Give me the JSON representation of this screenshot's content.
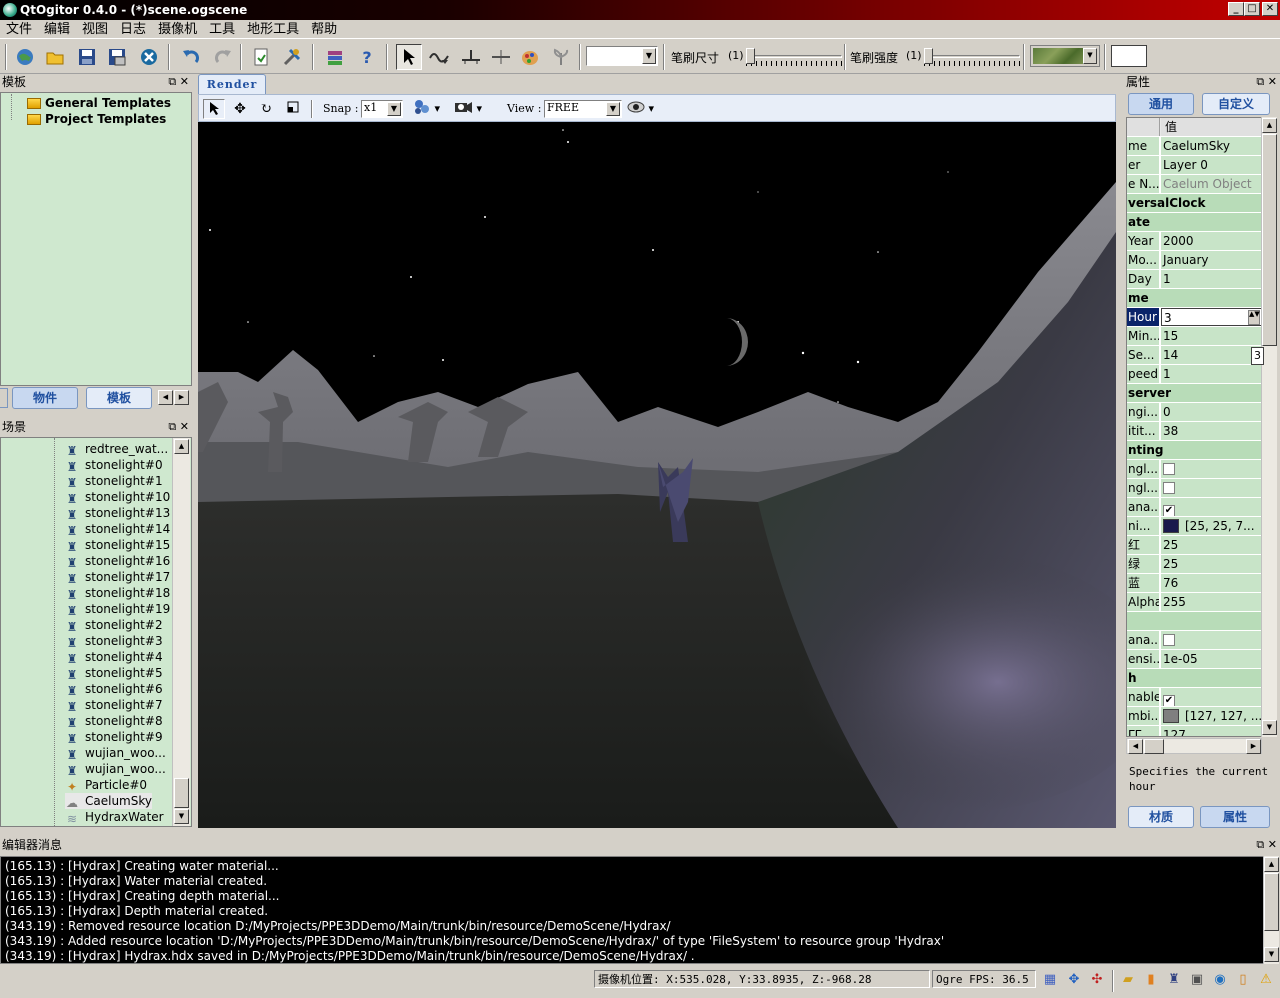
{
  "window": {
    "title": "QtOgitor 0.4.0 - (*)scene.ogscene",
    "minimize": "_",
    "maximize": "□",
    "close": "✕"
  },
  "menu": [
    "文件",
    "编辑",
    "视图",
    "日志",
    "摄像机",
    "工具",
    "地形工具",
    "帮助"
  ],
  "toolbar": {
    "brush_size_label": "笔刷尺寸",
    "brush_size_value": "(1)",
    "brush_strength_label": "笔刷强度",
    "brush_strength_value": "(1)",
    "mode_combo_value": ""
  },
  "templates_panel": {
    "title": "模板",
    "items": [
      "General Templates",
      "Project Templates"
    ],
    "tabs": [
      "物件",
      "模板"
    ]
  },
  "scene_panel": {
    "title": "场景",
    "items": [
      {
        "label": "redtree_wat...",
        "icon": "entity-icon"
      },
      {
        "label": "stonelight#0",
        "icon": "entity-icon"
      },
      {
        "label": "stonelight#1",
        "icon": "entity-icon"
      },
      {
        "label": "stonelight#10",
        "icon": "entity-icon"
      },
      {
        "label": "stonelight#13",
        "icon": "entity-icon"
      },
      {
        "label": "stonelight#14",
        "icon": "entity-icon"
      },
      {
        "label": "stonelight#15",
        "icon": "entity-icon"
      },
      {
        "label": "stonelight#16",
        "icon": "entity-icon"
      },
      {
        "label": "stonelight#17",
        "icon": "entity-icon"
      },
      {
        "label": "stonelight#18",
        "icon": "entity-icon"
      },
      {
        "label": "stonelight#19",
        "icon": "entity-icon"
      },
      {
        "label": "stonelight#2",
        "icon": "entity-icon"
      },
      {
        "label": "stonelight#3",
        "icon": "entity-icon"
      },
      {
        "label": "stonelight#4",
        "icon": "entity-icon"
      },
      {
        "label": "stonelight#5",
        "icon": "entity-icon"
      },
      {
        "label": "stonelight#6",
        "icon": "entity-icon"
      },
      {
        "label": "stonelight#7",
        "icon": "entity-icon"
      },
      {
        "label": "stonelight#8",
        "icon": "entity-icon"
      },
      {
        "label": "stonelight#9",
        "icon": "entity-icon"
      },
      {
        "label": "wujian_woo...",
        "icon": "entity-icon"
      },
      {
        "label": "wujian_woo...",
        "icon": "entity-icon"
      },
      {
        "label": "Particle#0",
        "icon": "particle-icon"
      },
      {
        "label": "CaelumSky",
        "icon": "sky-icon"
      },
      {
        "label": "HydraxWater",
        "icon": "water-icon"
      }
    ],
    "selected": "CaelumSky"
  },
  "render": {
    "tab": "Render",
    "snap_label": "Snap :",
    "snap_value": "x1",
    "view_label": "View :",
    "view_value": "FREE"
  },
  "properties_panel": {
    "title": "属性",
    "tabs": [
      "通用",
      "自定义"
    ],
    "header_value": "值",
    "rows": [
      {
        "k": "me",
        "v": "CaelumSky",
        "type": "text"
      },
      {
        "k": "er",
        "v": "Layer 0",
        "type": "text"
      },
      {
        "k": "e N...",
        "v": "Caelum Object",
        "type": "disabled"
      },
      {
        "k": "versalClock",
        "v": "",
        "type": "group"
      },
      {
        "k": "ate",
        "v": "",
        "type": "group"
      },
      {
        "k": "Year",
        "v": "2000",
        "type": "text"
      },
      {
        "k": "Mo...",
        "v": "January",
        "type": "text"
      },
      {
        "k": "Day",
        "v": "1",
        "type": "text"
      },
      {
        "k": "me",
        "v": "",
        "type": "group"
      },
      {
        "k": "Hour",
        "v": "3",
        "type": "editing"
      },
      {
        "k": "Min...",
        "v": "15",
        "type": "text"
      },
      {
        "k": "Se...",
        "v": "14",
        "type": "text"
      },
      {
        "k": "peed",
        "v": "1",
        "type": "text"
      },
      {
        "k": "server",
        "v": "",
        "type": "group"
      },
      {
        "k": "ngi...",
        "v": "0",
        "type": "text"
      },
      {
        "k": "itit...",
        "v": "38",
        "type": "text"
      },
      {
        "k": "nting",
        "v": "",
        "type": "group"
      },
      {
        "k": "ngl...",
        "v": "",
        "type": "check-off"
      },
      {
        "k": "ngl...",
        "v": "",
        "type": "check-off"
      },
      {
        "k": "ana...",
        "v": "",
        "type": "check-on"
      },
      {
        "k": "ni...",
        "v": "[25, 25, 7...",
        "type": "color",
        "color": "#19194c"
      },
      {
        "k": "红",
        "v": "25",
        "type": "text"
      },
      {
        "k": "绿",
        "v": "25",
        "type": "text"
      },
      {
        "k": "蓝",
        "v": "76",
        "type": "text"
      },
      {
        "k": "Alpha",
        "v": "255",
        "type": "text"
      },
      {
        "k": "",
        "v": "",
        "type": "group"
      },
      {
        "k": "ana...",
        "v": "",
        "type": "check-off"
      },
      {
        "k": "ensi...",
        "v": "1e-05",
        "type": "text"
      },
      {
        "k": "h",
        "v": "",
        "type": "group"
      },
      {
        "k": "nable",
        "v": "",
        "type": "check-on"
      },
      {
        "k": "mbi...",
        "v": "[127, 127, ...",
        "type": "color",
        "color": "#7f7f7f"
      },
      {
        "k": "ΓΓ",
        "v": "127",
        "type": "text"
      }
    ],
    "hour_popup": "3",
    "description": "Specifies the current hour",
    "bottom_tabs": [
      "材质",
      "属性"
    ]
  },
  "log_panel": {
    "title": "编辑器消息",
    "lines": [
      "(165.13) : [Hydrax] Creating water material...",
      "(165.13) : [Hydrax] Water material created.",
      "(165.13) : [Hydrax] Creating depth material...",
      "(165.13) : [Hydrax] Depth material created.",
      "(343.19) : Removed resource location D:/MyProjects/PPE3DDemo/Main/trunk/bin/resource/DemoScene/Hydrax/",
      "(343.19) : Added resource location 'D:/MyProjects/PPE3DDemo/Main/trunk/bin/resource/DemoScene/Hydrax/' of type 'FileSystem' to resource group 'Hydrax'",
      "(343.19) : [Hydrax] Hydrax.hdx saved in D:/MyProjects/PPE3DDemo/Main/trunk/bin/resource/DemoScene/Hydrax/ ."
    ]
  },
  "status": {
    "camera_position": "摄像机位置: X:535.028, Y:33.8935, Z:-968.28",
    "fps": "Ogre FPS: 36.5"
  },
  "colors": {
    "panel_green": "#cfe8cf",
    "title_red": "#c20000",
    "tab_blue": "#2050a0"
  }
}
